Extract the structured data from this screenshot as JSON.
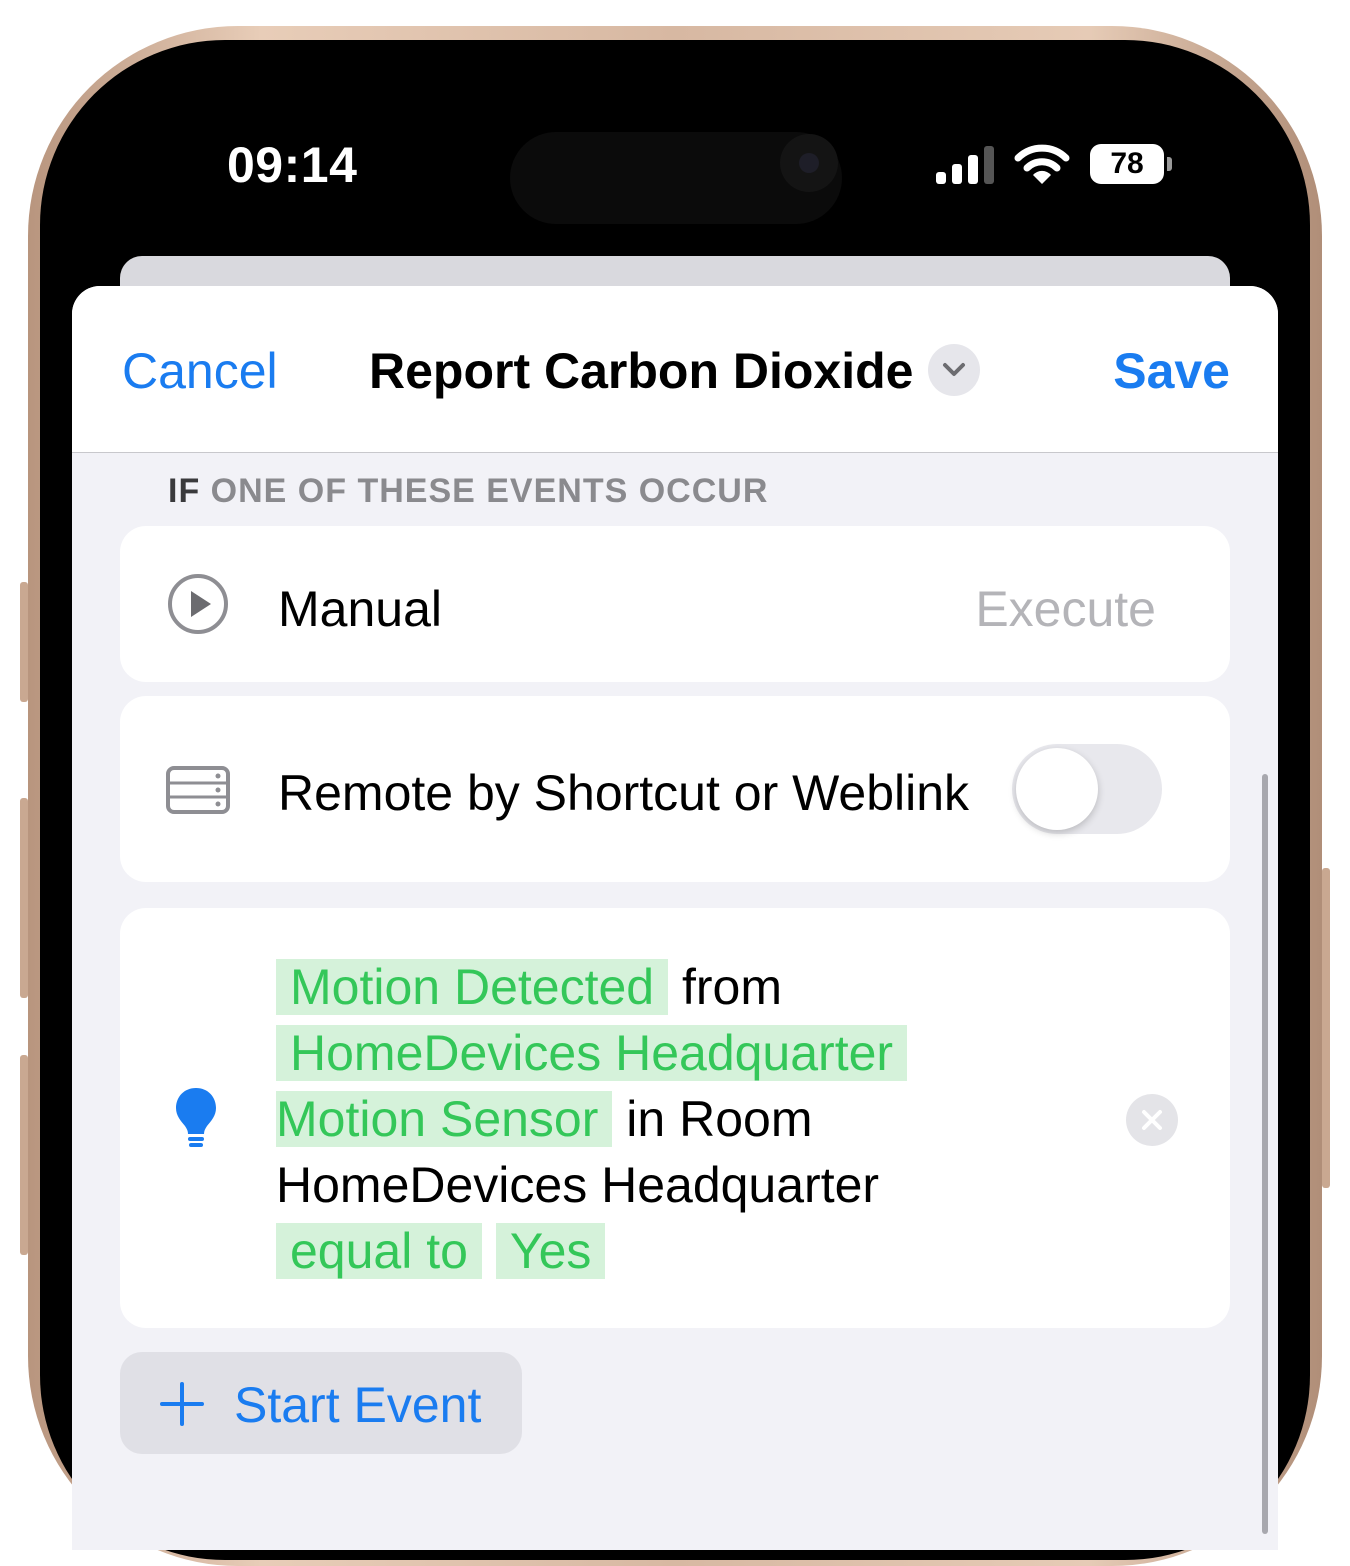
{
  "status_bar": {
    "time": "09:14",
    "battery": "78",
    "icons": [
      "cellular-signal-icon",
      "wifi-icon",
      "battery-icon"
    ]
  },
  "nav": {
    "cancel_label": "Cancel",
    "title": "Report Carbon Dioxide",
    "save_label": "Save"
  },
  "section": {
    "if_word": "IF",
    "rest": " ONE OF THESE EVENTS OCCUR"
  },
  "events": {
    "manual": {
      "label": "Manual",
      "action": "Execute",
      "icon": "play-circle-icon"
    },
    "remote": {
      "label": "Remote by Shortcut or Weblink",
      "icon": "server-icon",
      "enabled": false
    },
    "motion": {
      "icon": "lightbulb-icon",
      "trigger": "Motion Detected",
      "from_word": "from",
      "device_line1": "HomeDevices Headquarter",
      "device_line2": "Motion Sensor",
      "in_room_word": "in Room",
      "room": "HomeDevices Headquarter",
      "comparator": "equal to",
      "value": "Yes"
    }
  },
  "add_event": {
    "label": "Start Event"
  },
  "colors": {
    "accent": "#1a7cf0",
    "token_bg": "#d5f2da",
    "token_text": "#34c759",
    "background": "#f2f2f7"
  }
}
